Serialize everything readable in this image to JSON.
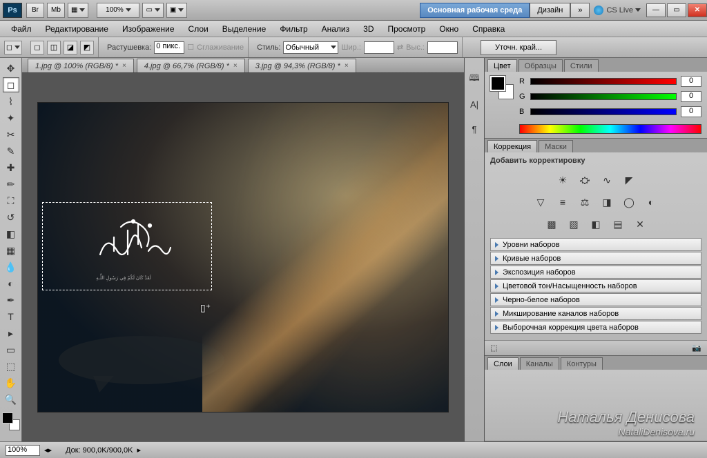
{
  "titlebar": {
    "zoom": "100%",
    "workspace_main": "Основная рабочая среда",
    "workspace_design": "Дизайн",
    "cslive": "CS Live"
  },
  "menu": [
    "Файл",
    "Редактирование",
    "Изображение",
    "Слои",
    "Выделение",
    "Фильтр",
    "Анализ",
    "3D",
    "Просмотр",
    "Окно",
    "Справка"
  ],
  "options": {
    "feather_label": "Растушевка:",
    "feather_value": "0 пикс.",
    "antialias_label": "Сглаживание",
    "style_label": "Стиль:",
    "style_value": "Обычный",
    "width_label": "Шир.:",
    "height_label": "Выс.:",
    "refine": "Уточн. край..."
  },
  "doc_tabs": [
    {
      "label": "1.jpg @ 100% (RGB/8) *"
    },
    {
      "label": "4.jpg @ 66,7% (RGB/8) *"
    },
    {
      "label": "3.jpg @ 94,3% (RGB/8) *"
    }
  ],
  "canvas": {
    "subtext": "لَقَدْ كَانَ لَكُمْ فِي رَسُولِ اللَّـهِ"
  },
  "color_panel": {
    "tabs": [
      "Цвет",
      "Образцы",
      "Стили"
    ],
    "channels": [
      {
        "name": "R",
        "value": "0"
      },
      {
        "name": "G",
        "value": "0"
      },
      {
        "name": "B",
        "value": "0"
      }
    ]
  },
  "adjust_panel": {
    "tabs": [
      "Коррекция",
      "Маски"
    ],
    "title": "Добавить корректировку",
    "presets": [
      "Уровни наборов",
      "Кривые наборов",
      "Экспозиция наборов",
      "Цветовой тон/Насыщенность наборов",
      "Черно-белое наборов",
      "Микширование каналов наборов",
      "Выборочная коррекция цвета наборов"
    ]
  },
  "layer_tabs": [
    "Слои",
    "Каналы",
    "Контуры"
  ],
  "status": {
    "zoom": "100%",
    "doc": "Док: 900,0K/900,0K"
  },
  "watermark": {
    "line1": "Наталья Денисова",
    "line2": "NataliDenisova.ru"
  }
}
